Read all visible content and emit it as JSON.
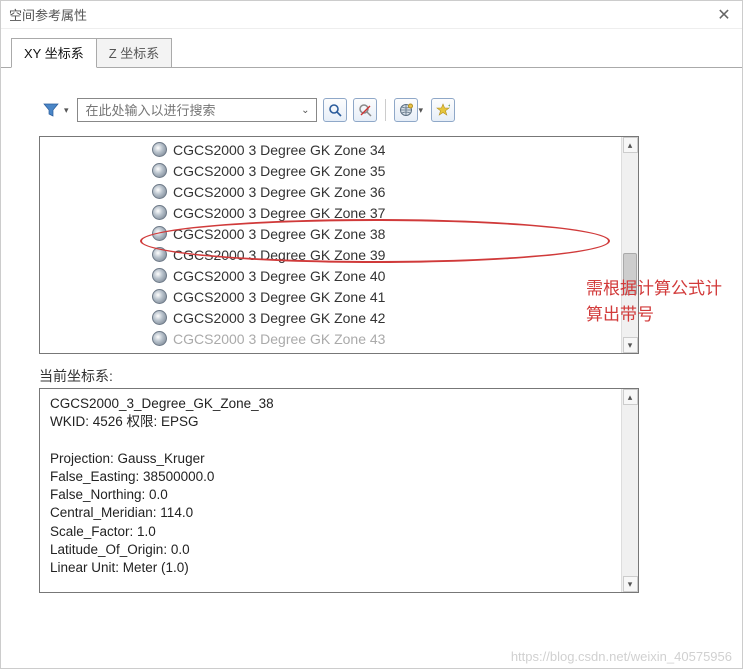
{
  "window": {
    "title": "空间参考属性"
  },
  "tabs": {
    "xy": "XY 坐标系",
    "z": "Z 坐标系"
  },
  "search": {
    "placeholder": "在此处输入以进行搜索"
  },
  "toolbar": {
    "filter_icon": "filter-icon",
    "search_go_icon": "search-go-icon",
    "search_clear_icon": "search-clear-icon",
    "new_crs_icon": "new-crs-icon",
    "fav_icon": "favorite-icon"
  },
  "list": {
    "items": [
      "CGCS2000 3 Degree GK Zone 34",
      "CGCS2000 3 Degree GK Zone 35",
      "CGCS2000 3 Degree GK Zone 36",
      "CGCS2000 3 Degree GK Zone 37",
      "CGCS2000 3 Degree GK Zone 38",
      "CGCS2000 3 Degree GK Zone 39",
      "CGCS2000 3 Degree GK Zone 40",
      "CGCS2000 3 Degree GK Zone 41",
      "CGCS2000 3 Degree GK Zone 42",
      "CGCS2000 3 Degree GK Zone 43"
    ],
    "selected_index": 4
  },
  "annotation": "需根据计算公式计算出带号",
  "current_label": "当前坐标系:",
  "details": {
    "name": "CGCS2000_3_Degree_GK_Zone_38",
    "wkid_line": "WKID: 4526 权限: EPSG",
    "projection": "Projection: Gauss_Kruger",
    "false_easting": "False_Easting: 38500000.0",
    "false_northing": "False_Northing: 0.0",
    "central_meridian": "Central_Meridian: 114.0",
    "scale_factor": "Scale_Factor: 1.0",
    "lat_origin": "Latitude_Of_Origin: 0.0",
    "linear_unit": "Linear Unit: Meter (1.0)"
  },
  "watermark": "https://blog.csdn.net/weixin_40575956",
  "colors": {
    "accent_red": "#d23a3a",
    "border": "#777"
  }
}
